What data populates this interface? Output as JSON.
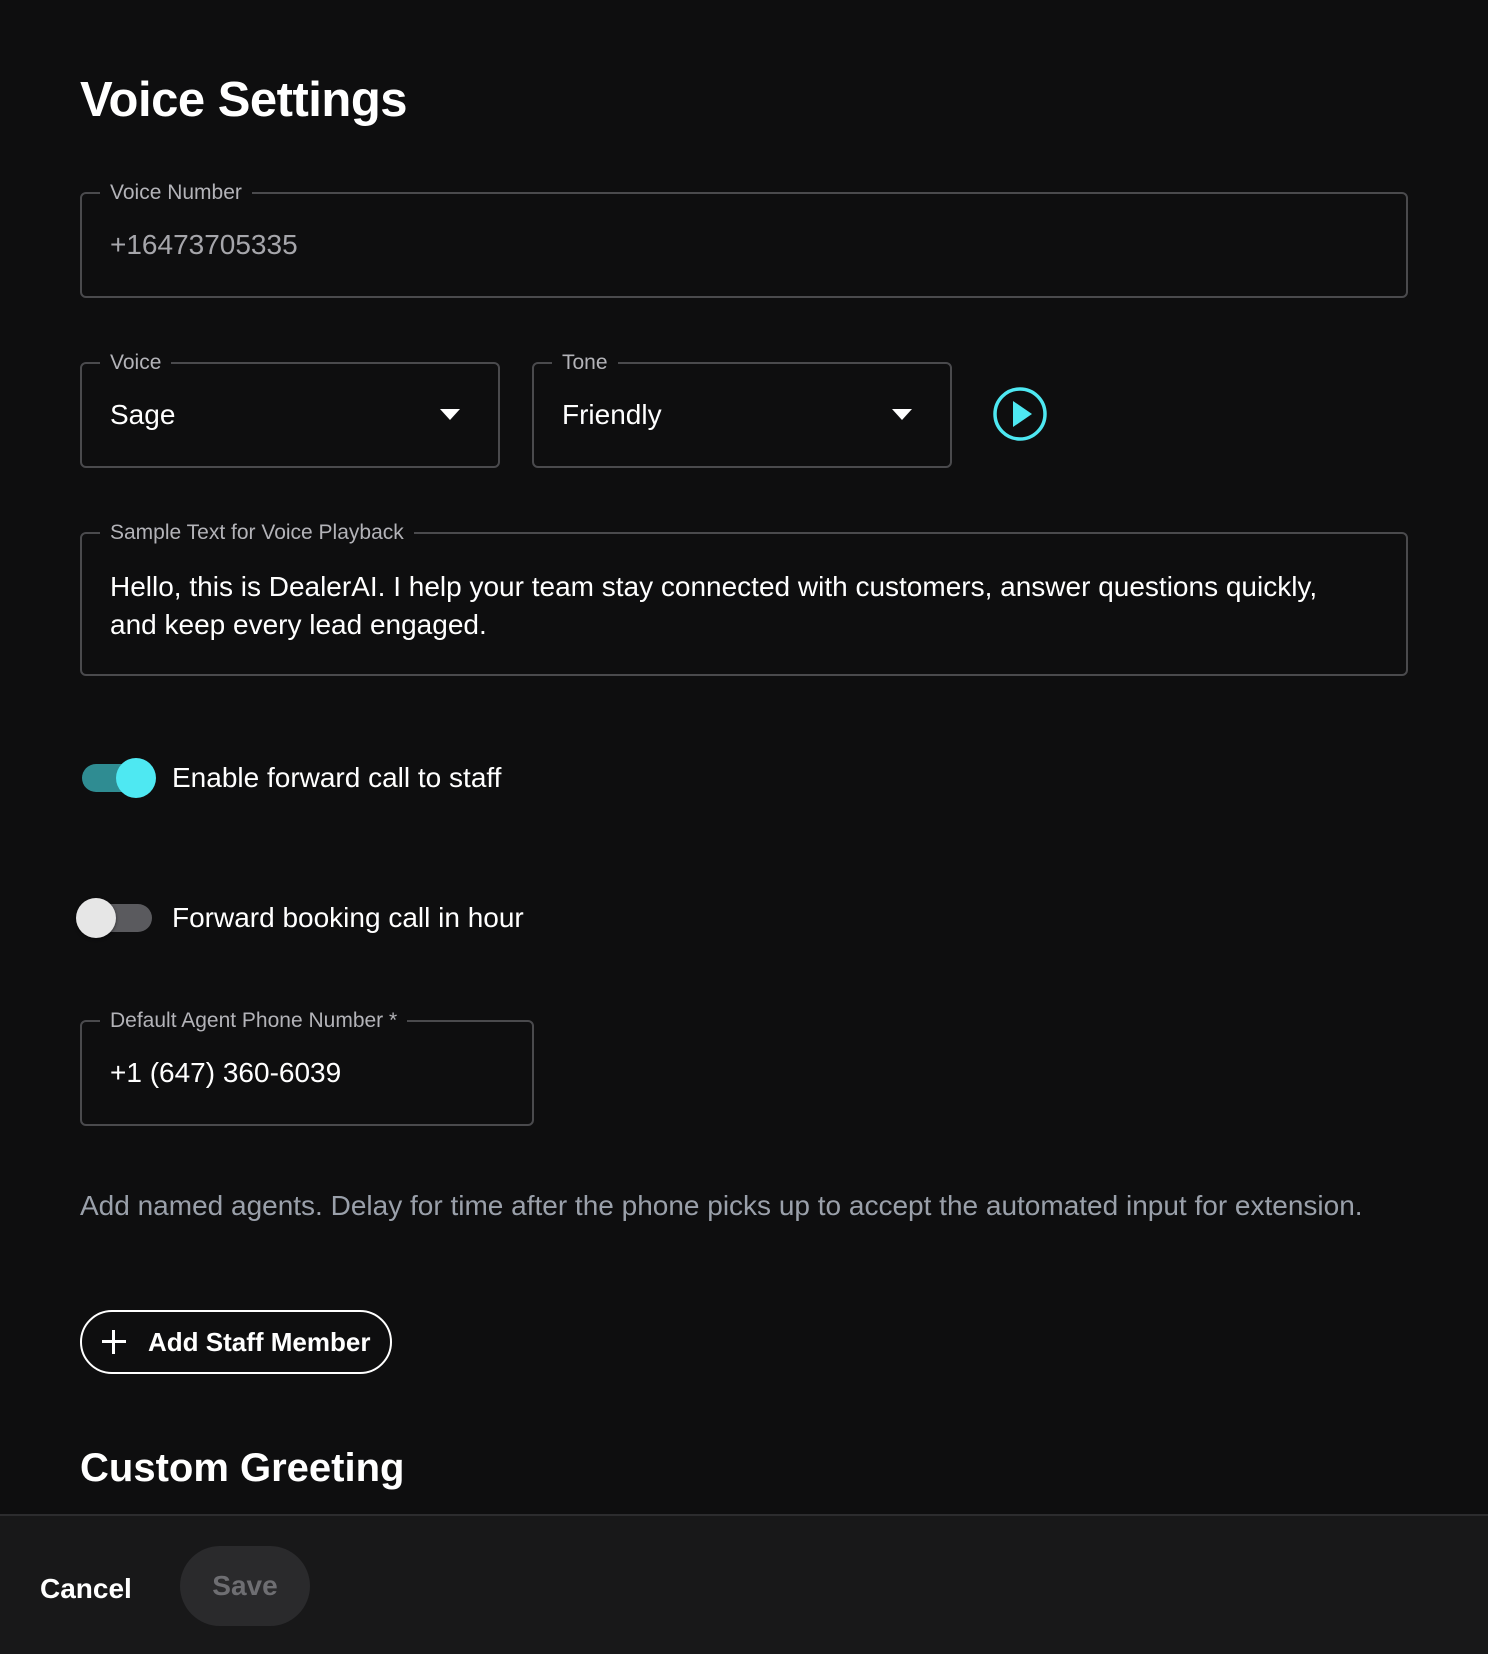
{
  "header": {
    "title": "Voice Settings"
  },
  "voice_number": {
    "label": "Voice Number",
    "value": "+16473705335"
  },
  "voice": {
    "label": "Voice",
    "selected": "Sage"
  },
  "tone": {
    "label": "Tone",
    "selected": "Friendly"
  },
  "sample_text": {
    "label": "Sample Text for Voice Playback",
    "value": "Hello, this is DealerAI. I help your team stay connected with customers, answer questions quickly, and keep every lead engaged."
  },
  "toggles": {
    "forward_call": {
      "label": "Enable forward call to staff",
      "on": true
    },
    "forward_booking": {
      "label": "Forward booking call in hour",
      "on": false
    }
  },
  "default_agent_phone": {
    "label": "Default Agent Phone Number *",
    "value": "+1 (647) 360-6039"
  },
  "helper_text": "Add named agents. Delay for time after the phone picks up to accept the automated input for extension.",
  "add_staff": {
    "label": "Add Staff Member",
    "icon": "plus-icon"
  },
  "custom_greeting": {
    "title": "Custom Greeting"
  },
  "footer": {
    "cancel_label": "Cancel",
    "save_label": "Save"
  },
  "colors": {
    "accent": "#4ee8f2",
    "background": "#0e0e0f",
    "footer_background": "#181819",
    "border": "#4a4a4d"
  }
}
